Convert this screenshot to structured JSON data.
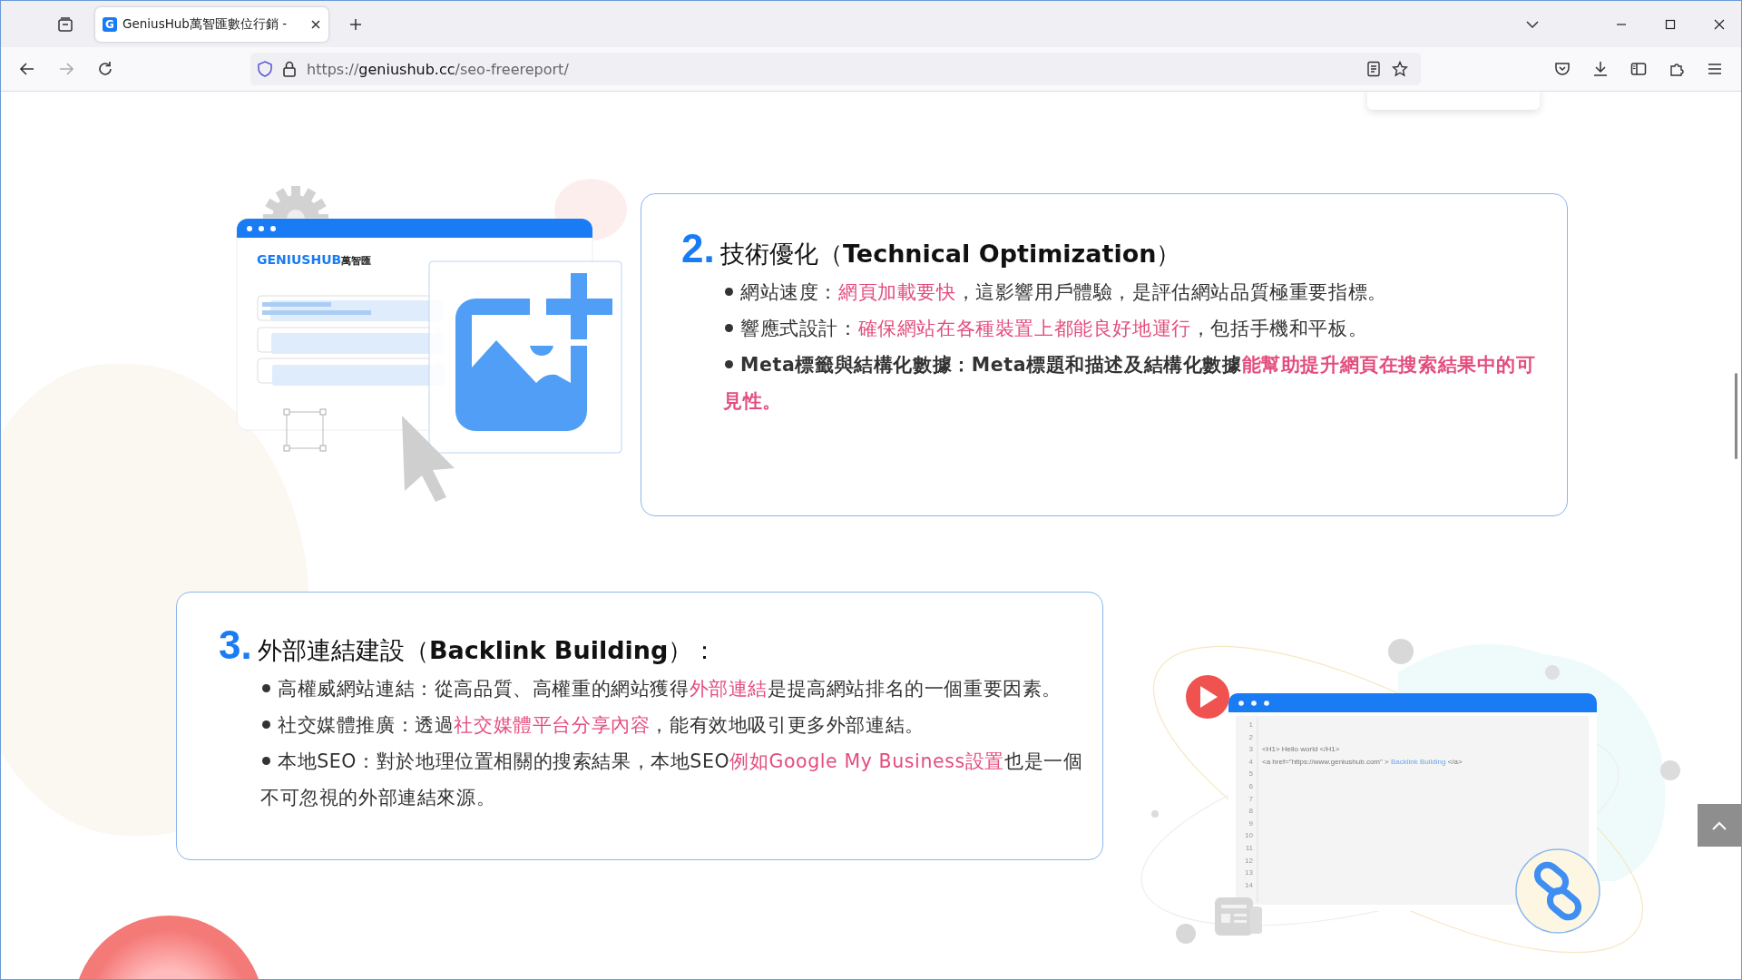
{
  "browser": {
    "tab": {
      "favicon": "G",
      "title": "GeniusHub萬智匯數位行銷 -"
    },
    "url": {
      "scheme": "https://",
      "host": "geniushub.cc",
      "path": "/seo-freereport/"
    },
    "forward_enabled": false
  },
  "sections": [
    {
      "number": "2.",
      "title": "技術優化（**Technical Optimization**）",
      "illustration": {
        "kind": "image-editor",
        "logo": "GENIUSHUB",
        "logo_cjk": "萬智匯"
      },
      "bullets": [
        {
          "bold": false,
          "segments": [
            {
              "text": "網站速度：",
              "highlight": false
            },
            {
              "text": "網頁加載要快",
              "highlight": true
            },
            {
              "text": "，這影響用戶體驗，是評估網站品質極重要指標。",
              "highlight": false
            }
          ]
        },
        {
          "bold": false,
          "segments": [
            {
              "text": "響應式設計：",
              "highlight": false
            },
            {
              "text": "確保網站在各種裝置上都能良好地運行",
              "highlight": true
            },
            {
              "text": "，包括手機和平板。",
              "highlight": false
            }
          ]
        },
        {
          "bold": true,
          "segments": [
            {
              "text": "Meta標籤與結構化數據：Meta標題和描述及結構化數據",
              "highlight": false
            },
            {
              "text": "能幫助提升網頁在搜索結果中的可見性。",
              "highlight": true
            }
          ]
        }
      ]
    },
    {
      "number": "3.",
      "title": "外部連結建設（**Backlink Building**）：",
      "illustration": {
        "kind": "code-editor",
        "lines": [
          {
            "number": "1"
          },
          {
            "number": "2"
          },
          {
            "number": "3",
            "code": [
              {
                "text": "<H1> Hello world </H1>",
                "link": false
              }
            ]
          },
          {
            "number": "4",
            "code": [
              {
                "text": "<a href=\"https://www.geniushub.com\" > ",
                "link": false
              },
              {
                "text": "Backlink Building",
                "link": true
              },
              {
                "text": " </a>",
                "link": false
              }
            ]
          },
          {
            "number": "5"
          },
          {
            "number": "6"
          },
          {
            "number": "7"
          },
          {
            "number": "8"
          },
          {
            "number": "9"
          },
          {
            "number": "10"
          },
          {
            "number": "11"
          },
          {
            "number": "12"
          },
          {
            "number": "13"
          },
          {
            "number": "14"
          }
        ]
      },
      "bullets": [
        {
          "bold": false,
          "segments": [
            {
              "text": "高權威網站連結：從高品質、高權重的網站獲得",
              "highlight": false
            },
            {
              "text": "外部連結",
              "highlight": true
            },
            {
              "text": "是提高網站排名的一個重要因素。",
              "highlight": false
            }
          ]
        },
        {
          "bold": false,
          "segments": [
            {
              "text": "社交媒體推廣：透過",
              "highlight": false
            },
            {
              "text": "社交媒體平台分享內容",
              "highlight": true
            },
            {
              "text": "，能有效地吸引更多外部連結。",
              "highlight": false
            }
          ]
        },
        {
          "bold": false,
          "segments": [
            {
              "text": "本地SEO：對於地理位置相關的搜索結果，本地SEO",
              "highlight": false
            },
            {
              "text": "例如Google My Business設置",
              "highlight": true
            },
            {
              "text": "也是一個不可忽視的外部連結來源。",
              "highlight": false
            }
          ]
        }
      ]
    }
  ]
}
